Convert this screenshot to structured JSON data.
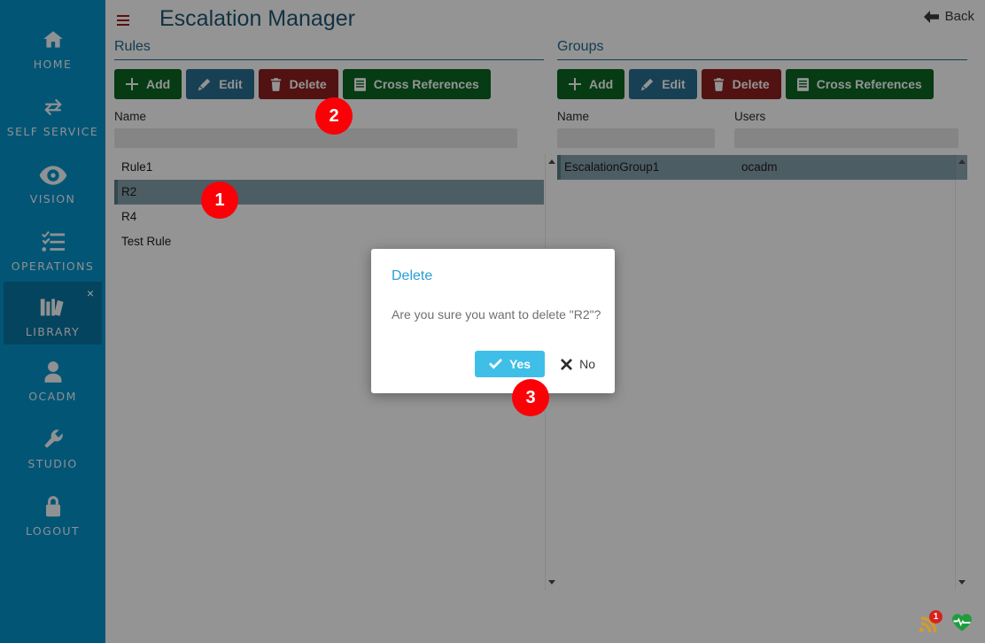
{
  "sidebar": {
    "items": [
      {
        "label": "HOME",
        "icon": "home-icon",
        "active": false
      },
      {
        "label": "SELF SERVICE",
        "icon": "exchange-icon",
        "active": false
      },
      {
        "label": "VISION",
        "icon": "eye-icon",
        "active": false
      },
      {
        "label": "OPERATIONS",
        "icon": "checklist-icon",
        "active": false
      },
      {
        "label": "LIBRARY",
        "icon": "books-icon",
        "active": true
      },
      {
        "label": "OCADM",
        "icon": "user-icon",
        "active": false
      },
      {
        "label": "STUDIO",
        "icon": "wrench-icon",
        "active": false
      },
      {
        "label": "LOGOUT",
        "icon": "lock-icon",
        "active": false
      }
    ],
    "close_label": "×",
    "bg_color": "#025575",
    "active_bg_color": "#05445e"
  },
  "header": {
    "title": "Escalation Manager",
    "menu_icon": "hamburger-icon",
    "back_label": "Back",
    "back_icon": "arrow-left-icon",
    "title_color": "#1f5673",
    "menu_icon_color": "#9c1c1c"
  },
  "rules_panel": {
    "title": "Rules",
    "toolbar": [
      {
        "label": "Add",
        "icon": "plus-icon",
        "color": "#0b6623"
      },
      {
        "label": "Edit",
        "icon": "pencil-icon",
        "color": "#2a6f93"
      },
      {
        "label": "Delete",
        "icon": "trash-icon",
        "color": "#8e2020"
      },
      {
        "label": "Cross References",
        "icon": "book-icon",
        "color": "#0b6623"
      }
    ],
    "columns": [
      "Name"
    ],
    "filter_values": [
      ""
    ],
    "filter_placeholder": "",
    "rows": [
      {
        "name": "Rule1",
        "selected": false
      },
      {
        "name": "R2",
        "selected": true
      },
      {
        "name": "R4",
        "selected": false
      },
      {
        "name": "Test Rule",
        "selected": false
      }
    ],
    "selected_row_color": "#86a0ad"
  },
  "groups_panel": {
    "title": "Groups",
    "toolbar": [
      {
        "label": "Add",
        "icon": "plus-icon",
        "color": "#0b6623"
      },
      {
        "label": "Edit",
        "icon": "pencil-icon",
        "color": "#2a6f93"
      },
      {
        "label": "Delete",
        "icon": "trash-icon",
        "color": "#8e2020"
      },
      {
        "label": "Cross References",
        "icon": "book-icon",
        "color": "#0b6623"
      }
    ],
    "columns": [
      "Name",
      "Users"
    ],
    "filter_values": [
      "",
      ""
    ],
    "rows": [
      {
        "name": "EscalationGroup1",
        "users": "ocadm",
        "selected": true
      }
    ]
  },
  "modal": {
    "title": "Delete",
    "message": "Are you sure you want to delete \"R2\"?",
    "yes_label": "Yes",
    "yes_icon": "check-icon",
    "no_label": "No",
    "no_icon": "close-icon",
    "yes_color": "#3fbfe8",
    "title_color": "#2a9fd6"
  },
  "status_icons": {
    "rss": {
      "icon": "rss-icon",
      "badge_count": "1",
      "badge_color": "#d9211c"
    },
    "health": {
      "icon": "heart-pulse-icon",
      "color": "#1f9d3e"
    }
  },
  "step_markers": [
    {
      "label": "1"
    },
    {
      "label": "2"
    },
    {
      "label": "3"
    }
  ]
}
